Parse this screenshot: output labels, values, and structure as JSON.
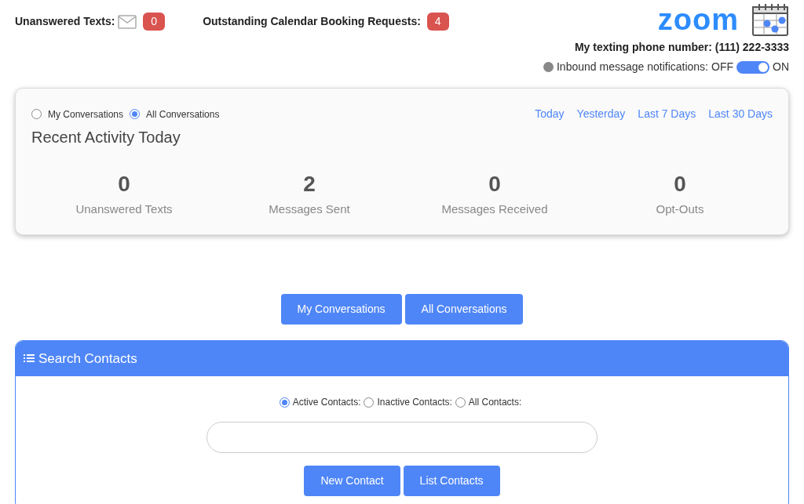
{
  "header": {
    "unanswered_label": "Unanswered Texts:",
    "unanswered_count": "0",
    "booking_label": "Outstanding Calendar Booking Requests:",
    "booking_count": "4",
    "logo": "zoom",
    "phone": "My texting phone number: (111) 222-3333",
    "notifications": {
      "label": "Inbound message notifications:",
      "off_label": "OFF",
      "on_label": "ON",
      "on": true
    }
  },
  "activity": {
    "scope_options": [
      {
        "label": "My Conversations",
        "selected": false
      },
      {
        "label": "All Conversations",
        "selected": true
      }
    ],
    "ranges": [
      "Today",
      "Yesterday",
      "Last 7 Days",
      "Last 30 Days"
    ],
    "title": "Recent Activity Today",
    "stats": [
      {
        "value": "0",
        "label": "Unanswered Texts"
      },
      {
        "value": "2",
        "label": "Messages Sent"
      },
      {
        "value": "0",
        "label": "Messages Received"
      },
      {
        "value": "0",
        "label": "Opt-Outs"
      }
    ]
  },
  "view_buttons": [
    "My Conversations",
    "All Conversations"
  ],
  "search": {
    "title": "Search Contacts",
    "filters": [
      {
        "label": "Active Contacts:",
        "selected": true
      },
      {
        "label": "Inactive Contacts:",
        "selected": false
      },
      {
        "label": "All Contacts:",
        "selected": false
      }
    ],
    "buttons": [
      "New Contact",
      "List Contacts"
    ]
  }
}
